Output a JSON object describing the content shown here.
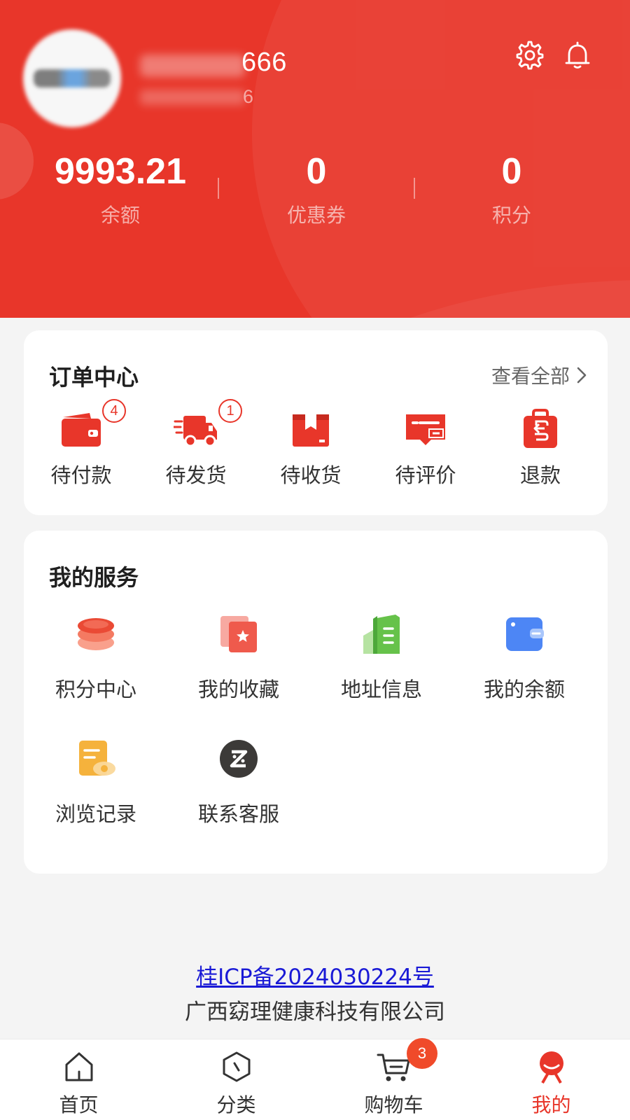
{
  "header": {
    "username_visible": "666",
    "phone_visible": "6",
    "stats": [
      {
        "value": "9993.21",
        "label": "余额"
      },
      {
        "value": "0",
        "label": "优惠券"
      },
      {
        "value": "0",
        "label": "积分"
      }
    ],
    "icons": [
      "gear-icon",
      "bell-icon"
    ]
  },
  "orders": {
    "title": "订单中心",
    "see_all": "查看全部",
    "items": [
      {
        "label": "待付款",
        "icon": "wallet-icon",
        "badge": "4"
      },
      {
        "label": "待发货",
        "icon": "truck-icon",
        "badge": "1"
      },
      {
        "label": "待收货",
        "icon": "package-icon"
      },
      {
        "label": "待评价",
        "icon": "comment-icon"
      },
      {
        "label": "退款",
        "icon": "refund-bag-icon"
      }
    ]
  },
  "services": {
    "title": "我的服务",
    "items": [
      {
        "label": "积分中心",
        "icon": "coins-stack-icon"
      },
      {
        "label": "我的收藏",
        "icon": "favorite-star-icon"
      },
      {
        "label": "地址信息",
        "icon": "building-icon"
      },
      {
        "label": "我的余额",
        "icon": "wallet-card-icon"
      },
      {
        "label": "浏览记录",
        "icon": "history-doc-icon"
      },
      {
        "label": "联系客服",
        "icon": "service-icon"
      }
    ]
  },
  "footer": {
    "icp": "桂ICP备2024030224号",
    "company": "广西窈理健康科技有限公司"
  },
  "tabbar": {
    "tabs": [
      {
        "label": "首页",
        "icon": "home-icon"
      },
      {
        "label": "分类",
        "icon": "category-icon"
      },
      {
        "label": "购物车",
        "icon": "cart-icon",
        "badge": "3"
      },
      {
        "label": "我的",
        "icon": "profile-icon",
        "active": true
      }
    ]
  },
  "colors": {
    "brand_red": "#e8362a",
    "background": "#f4f4f4",
    "link_blue": "#1a1ad6"
  }
}
